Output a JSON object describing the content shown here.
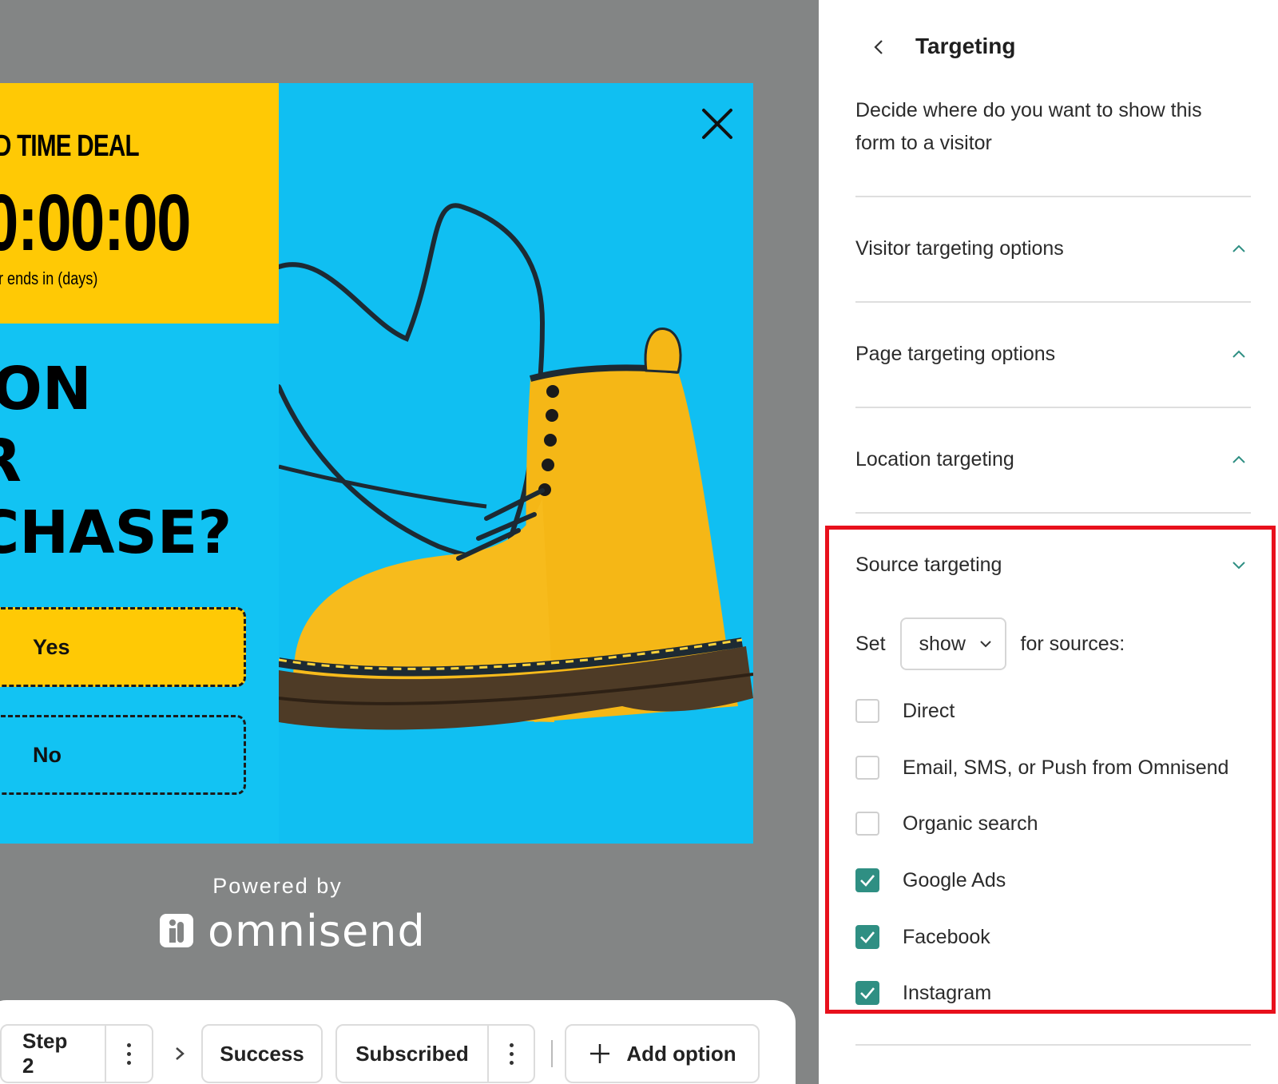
{
  "popup": {
    "deal_title": "ED TIME DEAL",
    "timer": "0:00:00",
    "timer_caption": "er ends in (days)",
    "headline_lines": [
      "ON",
      "R",
      "CHASE?"
    ],
    "yes_label": "Yes",
    "no_label": "No"
  },
  "branding": {
    "powered_by": "Powered by",
    "wordmark": "omnisend"
  },
  "steps": {
    "step2_label": "Step 2",
    "success_label": "Success",
    "subscribed_label": "Subscribed",
    "add_option_label": "Add option"
  },
  "panel": {
    "title": "Targeting",
    "description": "Decide where do you want to show this form to a visitor",
    "sections": [
      {
        "label": "Visitor targeting options",
        "expanded": false
      },
      {
        "label": "Page targeting options",
        "expanded": false
      },
      {
        "label": "Location targeting",
        "expanded": false
      },
      {
        "label": "Source targeting",
        "expanded": true
      }
    ],
    "source": {
      "set_label": "Set",
      "select_value": "show",
      "for_sources_label": "for sources:",
      "options": [
        {
          "label": "Direct",
          "checked": false
        },
        {
          "label": "Email, SMS, or Push from Omnisend",
          "checked": false
        },
        {
          "label": "Organic search",
          "checked": false
        },
        {
          "label": "Google Ads",
          "checked": true
        },
        {
          "label": "Facebook",
          "checked": true
        },
        {
          "label": "Instagram",
          "checked": true
        }
      ]
    }
  },
  "colors": {
    "canvas_bg": "#838585",
    "popup_cyan": "#12c3f3",
    "deal_yellow": "#ffc905",
    "checkbox_teal": "#2f8f83",
    "highlight_red": "#e8101c"
  }
}
